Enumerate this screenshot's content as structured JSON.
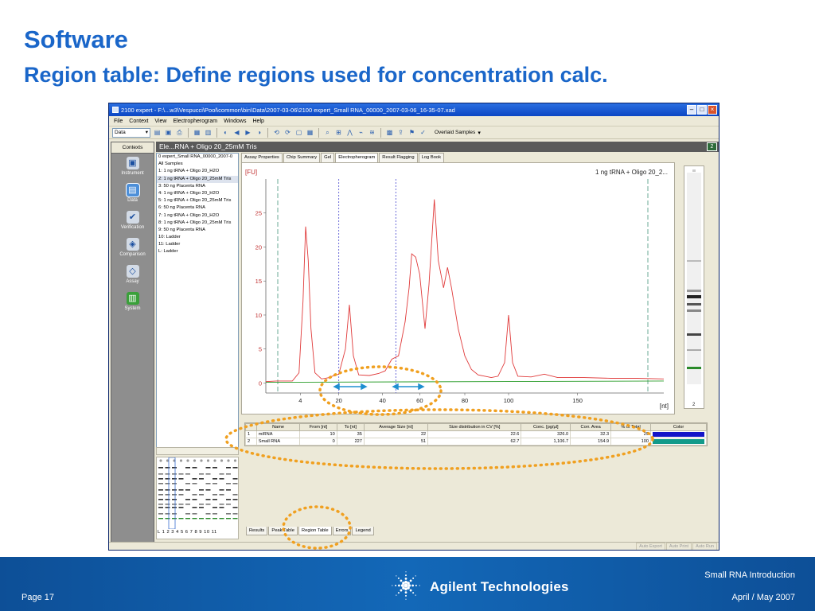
{
  "slide": {
    "title": "Software",
    "subtitle": "Region table: Define regions used for concentration calc."
  },
  "window": {
    "title": "2100 expert - F:\\...w3\\Vespucci\\Pool\\common\\bin\\Data\\2007-03-06\\2100 expert_Small RNA_00000_2007-03-06_16-35-07.xad"
  },
  "menu": [
    "File",
    "Context",
    "View",
    "Electropherogram",
    "Windows",
    "Help"
  ],
  "toolbar": {
    "context_select": "Data",
    "overlay_label": "Overlaid Samples"
  },
  "contexts": {
    "header": "Contexts",
    "items": [
      {
        "label": "Instrument",
        "icon": "instrument-icon"
      },
      {
        "label": "Data",
        "icon": "data-icon"
      },
      {
        "label": "Verification",
        "icon": "verification-icon"
      },
      {
        "label": "Comparison",
        "icon": "comparison-icon"
      },
      {
        "label": "Assay",
        "icon": "assay-icon"
      },
      {
        "label": "System",
        "icon": "system-icon"
      }
    ]
  },
  "document": {
    "header": "Ele...RNA + Oligo 20_25mM Tris",
    "number": "2"
  },
  "tree": [
    "0 expert_Small RNA_00000_2007-0",
    "All Samples",
    "1: 1 ng tRNA + Oligo 20_H2O",
    "2: 1 ng tRNA + Oligo 20_25mM Tris",
    "3: 50 ng Placenta RNA",
    "4: 1 ng tRNA + Oligo 20_H2O",
    "5: 1 ng tRNA + Oligo 20_25mM Tris",
    "6: 50 ng Placenta RNA",
    "7: 1 ng tRNA + Oligo 20_H2O",
    "8: 1 ng tRNA + Oligo 20_25mM Tris",
    "9: 50 ng Placenta RNA",
    "10: Ladder",
    "11: Ladder",
    "L: Ladder"
  ],
  "gel_lane_labels": "L  1  2  3  4  5  6  7  8  9  10 11",
  "top_tabs": [
    "Assay Properties",
    "Chip Summary",
    "Gel",
    "Electropherogram",
    "Result Flagging",
    "Log Book"
  ],
  "bottom_tabs": [
    "Results",
    "Peak Table",
    "Region Table",
    "Errors",
    "Legend"
  ],
  "chart_data": {
    "type": "line",
    "title": "1 ng tRNA + Oligo 20_2...",
    "ylabel": "[FU]",
    "xlabel": "[nt]",
    "ylim": [
      -1,
      30
    ],
    "yticks": [
      0,
      5,
      10,
      15,
      20,
      25
    ],
    "xticks": [
      "4",
      "20",
      "40",
      "60",
      "80",
      "100",
      "150"
    ],
    "series": [
      {
        "color": "#e03a3a",
        "points": [
          [
            0,
            0.2
          ],
          [
            0.08,
            0.3
          ],
          [
            0.2,
            0.3
          ],
          [
            0.25,
            1.5
          ],
          [
            0.28,
            12
          ],
          [
            0.3,
            23
          ],
          [
            0.32,
            18
          ],
          [
            0.34,
            8
          ],
          [
            0.37,
            1.5
          ],
          [
            0.42,
            0.6
          ],
          [
            0.48,
            0.8
          ],
          [
            0.5,
            1
          ],
          [
            0.55,
            1.3
          ],
          [
            0.6,
            5
          ],
          [
            0.63,
            11.5
          ],
          [
            0.66,
            4
          ],
          [
            0.7,
            1.2
          ],
          [
            0.78,
            1.1
          ],
          [
            0.85,
            1.4
          ],
          [
            0.9,
            1.8
          ],
          [
            0.95,
            3.5
          ],
          [
            1.0,
            4
          ],
          [
            1.05,
            9
          ],
          [
            1.08,
            14
          ],
          [
            1.1,
            19
          ],
          [
            1.13,
            18.5
          ],
          [
            1.16,
            16
          ],
          [
            1.2,
            8
          ],
          [
            1.23,
            14.5
          ],
          [
            1.27,
            27
          ],
          [
            1.3,
            18
          ],
          [
            1.34,
            14
          ],
          [
            1.37,
            17
          ],
          [
            1.4,
            14
          ],
          [
            1.45,
            8
          ],
          [
            1.5,
            4
          ],
          [
            1.55,
            2
          ],
          [
            1.6,
            1.2
          ],
          [
            1.7,
            0.8
          ],
          [
            1.75,
            1.0
          ],
          [
            1.8,
            3
          ],
          [
            1.83,
            10
          ],
          [
            1.86,
            3
          ],
          [
            1.9,
            1
          ],
          [
            2.0,
            0.9
          ],
          [
            2.1,
            1.3
          ],
          [
            2.2,
            0.8
          ],
          [
            2.4,
            0.8
          ],
          [
            2.6,
            0.7
          ],
          [
            2.8,
            0.7
          ],
          [
            3.0,
            0.6
          ]
        ]
      },
      {
        "color": "#2a9d2a",
        "points": [
          [
            0,
            0.1
          ],
          [
            3.0,
            0.3
          ]
        ]
      }
    ],
    "markers": {
      "region_lines": [
        0.55,
        0.98
      ],
      "dashed_lines": [
        0.09,
        2.88
      ]
    }
  },
  "region_table": {
    "columns": [
      "",
      "Name",
      "From [nt]",
      "To [nt]",
      "Average Size [nt]",
      "Size distribution in CV [%]",
      "Conc. [pg/µl]",
      "Corr. Area",
      "% of Total",
      "Color"
    ],
    "rows": [
      [
        "1",
        "miRNA",
        "10",
        "35",
        "22",
        "22.6",
        "326.0",
        "32.3",
        "29",
        "#1414c8"
      ],
      [
        "2",
        "Small RNA",
        "0",
        "227",
        "51",
        "62.7",
        "1,106.7",
        "154.9",
        "100",
        "#129a8a"
      ]
    ]
  },
  "status": [
    "Auto Export",
    "Auto Print",
    "Auto Run"
  ],
  "gel_lane_number": "2",
  "footer": {
    "page": "Page 17",
    "brand": "Agilent Technologies",
    "topic": "Small RNA Introduction",
    "date": "April / May 2007"
  },
  "colors": {
    "accent": "#1a66c9",
    "annotation": "#f0a020",
    "arrow": "#1f8fd0"
  }
}
